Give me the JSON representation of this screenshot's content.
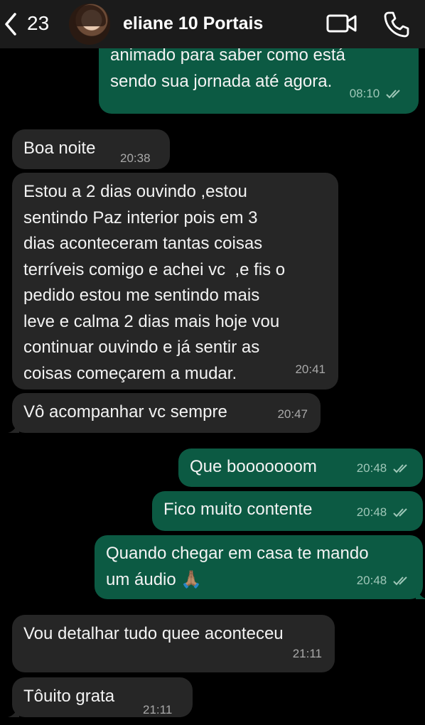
{
  "header": {
    "back_count": "23",
    "contact_name": "eliane 10 Portais"
  },
  "messages": [
    {
      "direction": "out",
      "text": "animado para saber como está\nsendo sua jornada até agora.",
      "time": "08:10",
      "read": true
    },
    {
      "direction": "in",
      "text": "Boa noite",
      "time": "20:38"
    },
    {
      "direction": "in",
      "text": "Estou a 2 dias ouvindo ,estou\nsentindo Paz interior pois em 3\ndias aconteceram tantas coisas\nterríveis comigo e achei vc  ,e fis o\npedido estou me sentindo mais\nleve e calma 2 dias mais hoje vou\ncontinuar ouvindo e já sentir as\ncoisas começarem a mudar.",
      "time": "20:41"
    },
    {
      "direction": "in",
      "text": "Vô acompanhar vc sempre",
      "time": "20:47"
    },
    {
      "direction": "out",
      "text": "Que booooooom",
      "time": "20:48",
      "read": true
    },
    {
      "direction": "out",
      "text": "Fico muito contente",
      "time": "20:48",
      "read": true
    },
    {
      "direction": "out",
      "text": "Quando chegar em casa te mando\num áudio 🙏🏽",
      "time": "20:48",
      "read": true
    },
    {
      "direction": "in",
      "text": "Vou detalhar tudo quee aconteceu",
      "time": "21:11"
    },
    {
      "direction": "in",
      "text": "Tôuito grata",
      "time": "21:11"
    }
  ],
  "colors": {
    "background": "#000000",
    "header": "#1b1b1b",
    "incoming_bubble": "#262626",
    "outgoing_bubble": "#0c5a43"
  }
}
